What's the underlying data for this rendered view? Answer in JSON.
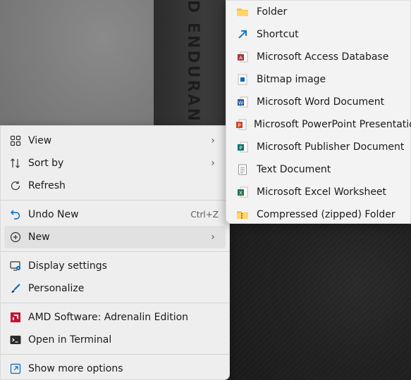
{
  "wallpaper": {
    "text": "D ENDURAN"
  },
  "context_menu": {
    "items": [
      {
        "label": "View",
        "icon": "view-grid-icon",
        "submenu": true
      },
      {
        "label": "Sort by",
        "icon": "sort-icon",
        "submenu": true
      },
      {
        "label": "Refresh",
        "icon": "refresh-icon"
      },
      {
        "label": "Undo New",
        "icon": "undo-icon",
        "shortcut": "Ctrl+Z"
      },
      {
        "label": "New",
        "icon": "plus-circle-icon",
        "submenu": true
      },
      {
        "label": "Display settings",
        "icon": "display-settings-icon"
      },
      {
        "label": "Personalize",
        "icon": "brush-icon"
      },
      {
        "label": "AMD Software: Adrenalin Edition",
        "icon": "amd-icon"
      },
      {
        "label": "Open in Terminal",
        "icon": "terminal-icon"
      },
      {
        "label": "Show more options",
        "icon": "show-more-icon"
      }
    ]
  },
  "new_submenu": {
    "items": [
      {
        "label": "Folder",
        "icon": "folder-icon"
      },
      {
        "label": "Shortcut",
        "icon": "shortcut-icon"
      },
      {
        "label": "Microsoft Access Database",
        "icon": "access-icon"
      },
      {
        "label": "Bitmap image",
        "icon": "bitmap-icon"
      },
      {
        "label": "Microsoft Word Document",
        "icon": "word-icon"
      },
      {
        "label": "Microsoft PowerPoint Presentation",
        "icon": "powerpoint-icon"
      },
      {
        "label": "Microsoft Publisher Document",
        "icon": "publisher-icon"
      },
      {
        "label": "Text Document",
        "icon": "text-document-icon"
      },
      {
        "label": "Microsoft Excel Worksheet",
        "icon": "excel-icon"
      },
      {
        "label": "Compressed (zipped) Folder",
        "icon": "zip-folder-icon"
      }
    ]
  },
  "colors": {
    "accent": "#0067c0",
    "amd": "#c8102e",
    "access": "#a4373a",
    "word": "#2b579a",
    "powerpoint": "#d24726",
    "publisher": "#077568",
    "excel": "#217346",
    "folder": "#f8c24b"
  }
}
